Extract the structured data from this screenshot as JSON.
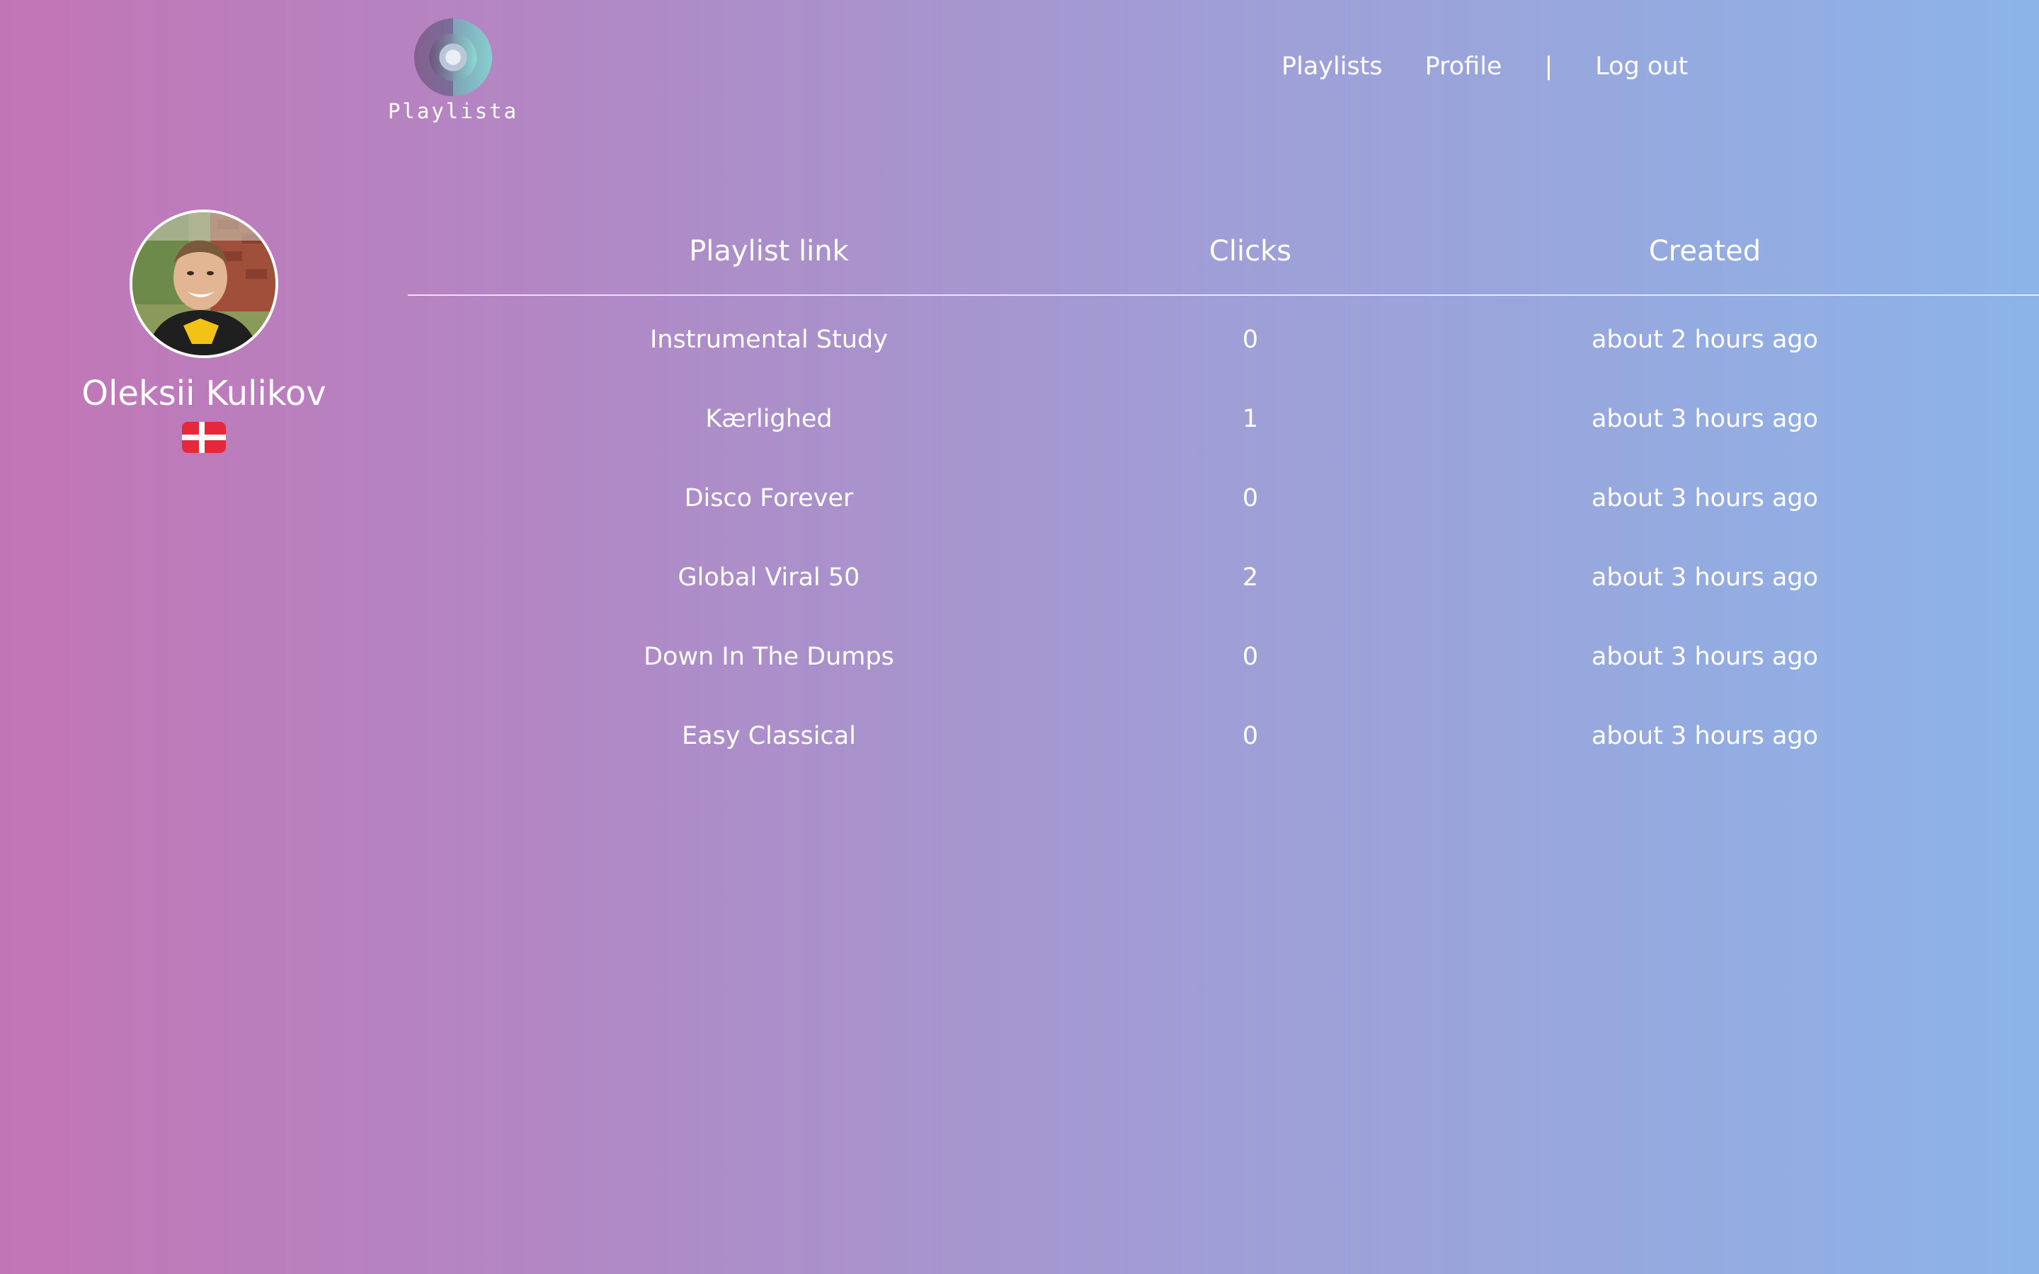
{
  "brand": {
    "name": "Playlista",
    "logo_icon": "vinyl-disc-icon"
  },
  "nav": {
    "items": [
      {
        "label": "Playlists"
      },
      {
        "label": "Profile"
      }
    ],
    "separator": "|",
    "logout_label": "Log out"
  },
  "profile": {
    "name": "Oleksii Kulikov",
    "avatar_icon": "user-photo",
    "flag_icon": "denmark-flag-icon",
    "flag_colors": {
      "red": "#e5283b",
      "white": "#ffffff"
    }
  },
  "table": {
    "headers": [
      "Playlist link",
      "Clicks",
      "Created"
    ],
    "rows": [
      {
        "playlist": "Instrumental Study",
        "clicks": "0",
        "created": "about 2 hours ago"
      },
      {
        "playlist": "Kærlighed",
        "clicks": "1",
        "created": "about 3 hours ago"
      },
      {
        "playlist": "Disco Forever",
        "clicks": "0",
        "created": "about 3 hours ago"
      },
      {
        "playlist": "Global Viral 50",
        "clicks": "2",
        "created": "about 3 hours ago"
      },
      {
        "playlist": "Down In The Dumps",
        "clicks": "0",
        "created": "about 3 hours ago"
      },
      {
        "playlist": "Easy Classical",
        "clicks": "0",
        "created": "about 3 hours ago"
      }
    ]
  },
  "colors": {
    "gradient_start": "#c275b6",
    "gradient_end": "#8cb4e8",
    "text": "#ffffff"
  }
}
